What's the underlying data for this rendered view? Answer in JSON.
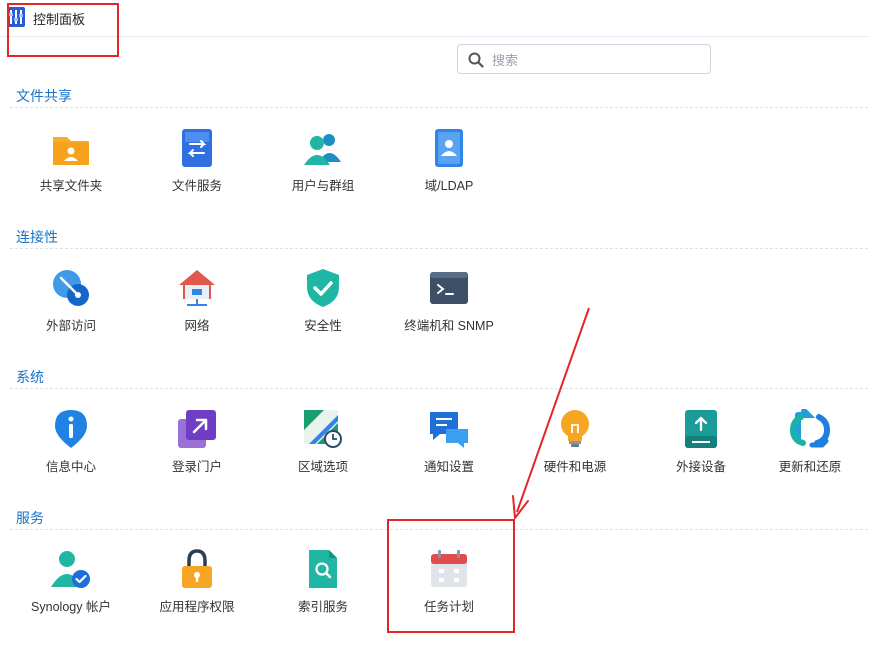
{
  "window": {
    "title": "控制面板"
  },
  "search": {
    "placeholder": "搜索"
  },
  "sections": [
    {
      "title": "文件共享",
      "items": [
        {
          "label": "共享文件夹",
          "icon": "shared-folder-icon"
        },
        {
          "label": "文件服务",
          "icon": "file-services-icon"
        },
        {
          "label": "用户与群组",
          "icon": "user-group-icon"
        },
        {
          "label": "域/LDAP",
          "icon": "domain-ldap-icon"
        }
      ]
    },
    {
      "title": "连接性",
      "items": [
        {
          "label": "外部访问",
          "icon": "external-access-icon"
        },
        {
          "label": "网络",
          "icon": "network-icon"
        },
        {
          "label": "安全性",
          "icon": "security-shield-icon"
        },
        {
          "label": "终端机和 SNMP",
          "icon": "terminal-icon"
        }
      ]
    },
    {
      "title": "系统",
      "items": [
        {
          "label": "信息中心",
          "icon": "info-center-icon"
        },
        {
          "label": "登录门户",
          "icon": "login-portal-icon"
        },
        {
          "label": "区域选项",
          "icon": "regional-options-icon"
        },
        {
          "label": "通知设置",
          "icon": "notification-icon"
        },
        {
          "label": "硬件和电源",
          "icon": "hardware-power-icon"
        },
        {
          "label": "外接设备",
          "icon": "external-devices-icon"
        },
        {
          "label": "更新和还原",
          "icon": "update-restore-icon"
        }
      ]
    },
    {
      "title": "服务",
      "items": [
        {
          "label": "Synology 帐户",
          "icon": "synology-account-icon"
        },
        {
          "label": "应用程序权限",
          "icon": "app-privileges-icon"
        },
        {
          "label": "索引服务",
          "icon": "indexing-service-icon"
        },
        {
          "label": "任务计划",
          "icon": "task-scheduler-icon"
        }
      ]
    }
  ],
  "colors": {
    "section_title": "#1a73c8",
    "annotation": "#e4252a"
  }
}
